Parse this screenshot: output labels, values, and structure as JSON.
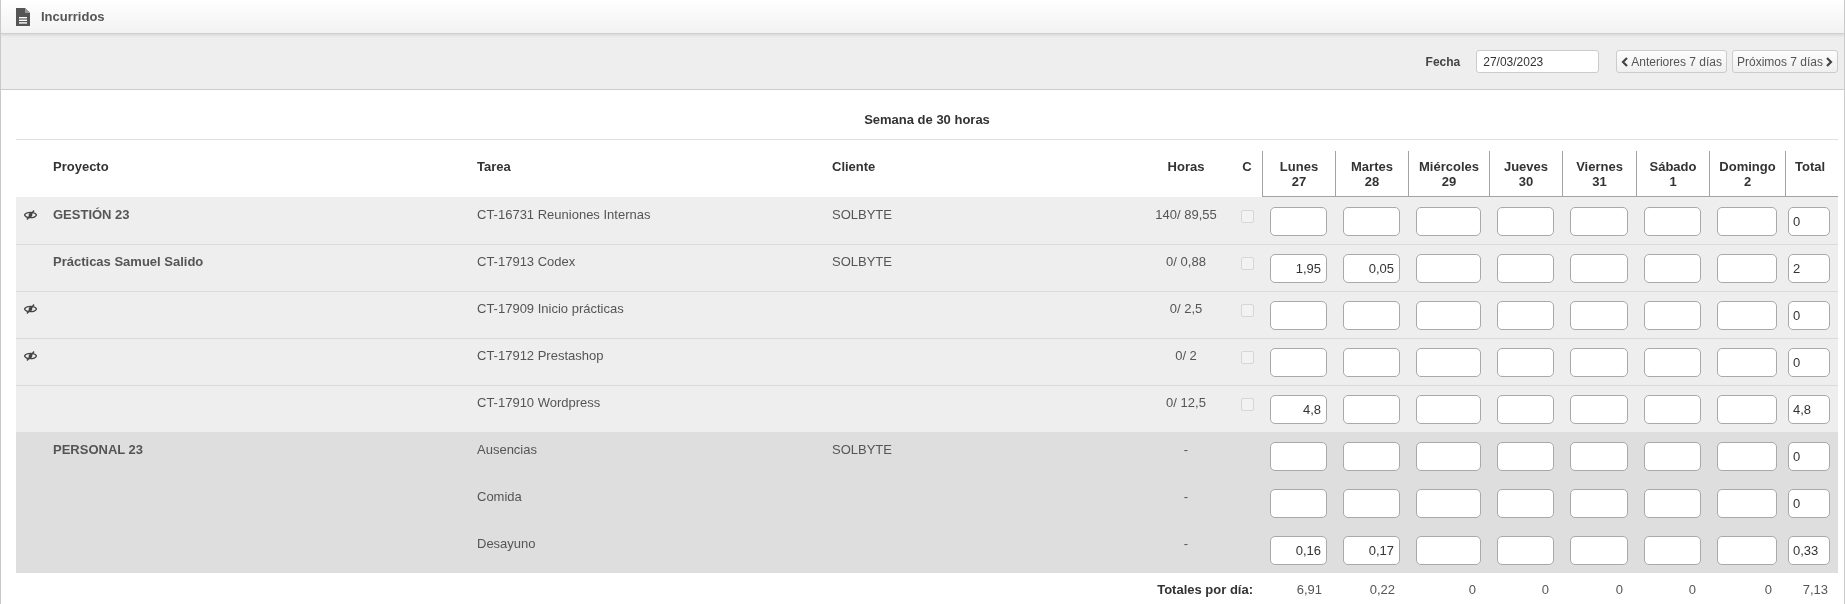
{
  "title_bar": {
    "title": "Incurridos"
  },
  "toolbar": {
    "date_label": "Fecha",
    "date_value": "27/03/2023",
    "prev_button": "Anteriores 7 días",
    "next_button": "Próximos 7 días"
  },
  "week_title": "Semana de 30 horas",
  "table": {
    "columns": [
      "Proyecto",
      "Tarea",
      "Cliente",
      "Horas",
      "C"
    ],
    "days": [
      {
        "name": "Lunes",
        "date": "27"
      },
      {
        "name": "Martes",
        "date": "28"
      },
      {
        "name": "Miércoles",
        "date": "29"
      },
      {
        "name": "Jueves",
        "date": "30"
      },
      {
        "name": "Viernes",
        "date": "31"
      },
      {
        "name": "Sábado",
        "date": "1"
      },
      {
        "name": "Domingo",
        "date": "2"
      }
    ],
    "total_column": "Total",
    "groups": [
      {
        "kind": "project",
        "rows": [
          {
            "eye_toggle": true,
            "project": "GESTIÓN 23",
            "task": "CT-16731 Reuniones Internas",
            "client": "SOLBYTE",
            "hours": "140/ 89,55",
            "checkbox": {
              "checked": false
            },
            "days": [
              {
                "kind": "empty"
              },
              {
                "kind": "empty"
              },
              {
                "kind": "empty"
              },
              {
                "kind": "empty"
              },
              {
                "kind": "empty"
              },
              {
                "kind": "empty"
              },
              {
                "kind": "empty"
              }
            ],
            "total": "0"
          },
          {
            "eye_toggle": false,
            "project": "Prácticas Samuel Salido",
            "task": "CT-17913 Codex",
            "client": "SOLBYTE",
            "hours": "0/ 0,88",
            "checkbox": {
              "checked": false
            },
            "days": [
              {
                "kind": "filled",
                "value": "1,95"
              },
              {
                "kind": "filled",
                "value": "0,05"
              },
              {
                "kind": "empty"
              },
              {
                "kind": "empty"
              },
              {
                "kind": "empty"
              },
              {
                "kind": "empty"
              },
              {
                "kind": "empty"
              }
            ],
            "total": "2"
          },
          {
            "eye_toggle": true,
            "task": "CT-17909 Inicio prácticas",
            "hours": "0/ 2,5",
            "checkbox": {
              "checked": false
            },
            "days": [
              {
                "kind": "empty"
              },
              {
                "kind": "empty"
              },
              {
                "kind": "empty"
              },
              {
                "kind": "empty"
              },
              {
                "kind": "empty"
              },
              {
                "kind": "empty"
              },
              {
                "kind": "empty"
              }
            ],
            "total": "0"
          },
          {
            "eye_toggle": true,
            "task": "CT-17912 Prestashop",
            "hours": "0/ 2",
            "checkbox": {
              "checked": false
            },
            "days": [
              {
                "kind": "empty"
              },
              {
                "kind": "empty"
              },
              {
                "kind": "empty"
              },
              {
                "kind": "empty"
              },
              {
                "kind": "empty"
              },
              {
                "kind": "empty"
              },
              {
                "kind": "empty"
              }
            ],
            "total": "0"
          },
          {
            "eye_toggle": false,
            "task": "CT-17910 Wordpress",
            "hours": "0/ 12,5",
            "checkbox": {
              "checked": false
            },
            "days": [
              {
                "kind": "filled",
                "value": "4,8"
              },
              {
                "kind": "empty"
              },
              {
                "kind": "empty"
              },
              {
                "kind": "empty"
              },
              {
                "kind": "empty"
              },
              {
                "kind": "empty"
              },
              {
                "kind": "empty"
              }
            ],
            "total": "4,8"
          }
        ]
      },
      {
        "kind": "personal",
        "rows": [
          {
            "eye_toggle": false,
            "project": "PERSONAL 23",
            "task": "Ausencias",
            "client": "SOLBYTE",
            "hours": "-",
            "days": [
              {
                "kind": "empty"
              },
              {
                "kind": "empty"
              },
              {
                "kind": "empty"
              },
              {
                "kind": "empty"
              },
              {
                "kind": "empty"
              },
              {
                "kind": "empty"
              },
              {
                "kind": "empty"
              }
            ],
            "total": "0"
          },
          {
            "eye_toggle": false,
            "task": "Comida",
            "hours": "-",
            "days": [
              {
                "kind": "empty"
              },
              {
                "kind": "empty"
              },
              {
                "kind": "empty"
              },
              {
                "kind": "empty"
              },
              {
                "kind": "empty"
              },
              {
                "kind": "empty"
              },
              {
                "kind": "empty"
              }
            ],
            "total": "0"
          },
          {
            "eye_toggle": false,
            "task": "Desayuno",
            "hours": "-",
            "days": [
              {
                "kind": "filled",
                "value": "0,16"
              },
              {
                "kind": "filled",
                "value": "0,17"
              },
              {
                "kind": "empty"
              },
              {
                "kind": "empty"
              },
              {
                "kind": "empty"
              },
              {
                "kind": "empty"
              },
              {
                "kind": "empty"
              }
            ],
            "total": "0,33"
          }
        ]
      }
    ],
    "totals": {
      "label": "Totales por día:",
      "values": [
        "6,91",
        "0,22",
        "0",
        "0",
        "0",
        "0",
        "0"
      ],
      "total": "7,13"
    }
  }
}
